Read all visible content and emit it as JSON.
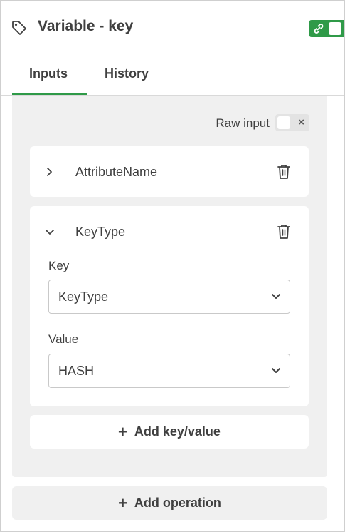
{
  "header": {
    "title": "Variable - key",
    "icon": "tag-icon",
    "toggle_color": "#2f9a48"
  },
  "tabs": [
    {
      "label": "Inputs",
      "active": true
    },
    {
      "label": "History",
      "active": false
    }
  ],
  "raw_input": {
    "label": "Raw input",
    "toggle_symbol": "×"
  },
  "items": [
    {
      "name": "AttributeName",
      "expanded": false
    },
    {
      "name": "KeyType",
      "expanded": true,
      "key_label": "Key",
      "key_value": "KeyType",
      "value_label": "Value",
      "value_value": "HASH"
    }
  ],
  "buttons": {
    "add_key_value": "Add key/value",
    "add_operation": "Add operation",
    "plus": "+"
  },
  "colors": {
    "accent": "#2f9a48",
    "panel_bg": "#f0f0f0",
    "text": "#404040"
  }
}
